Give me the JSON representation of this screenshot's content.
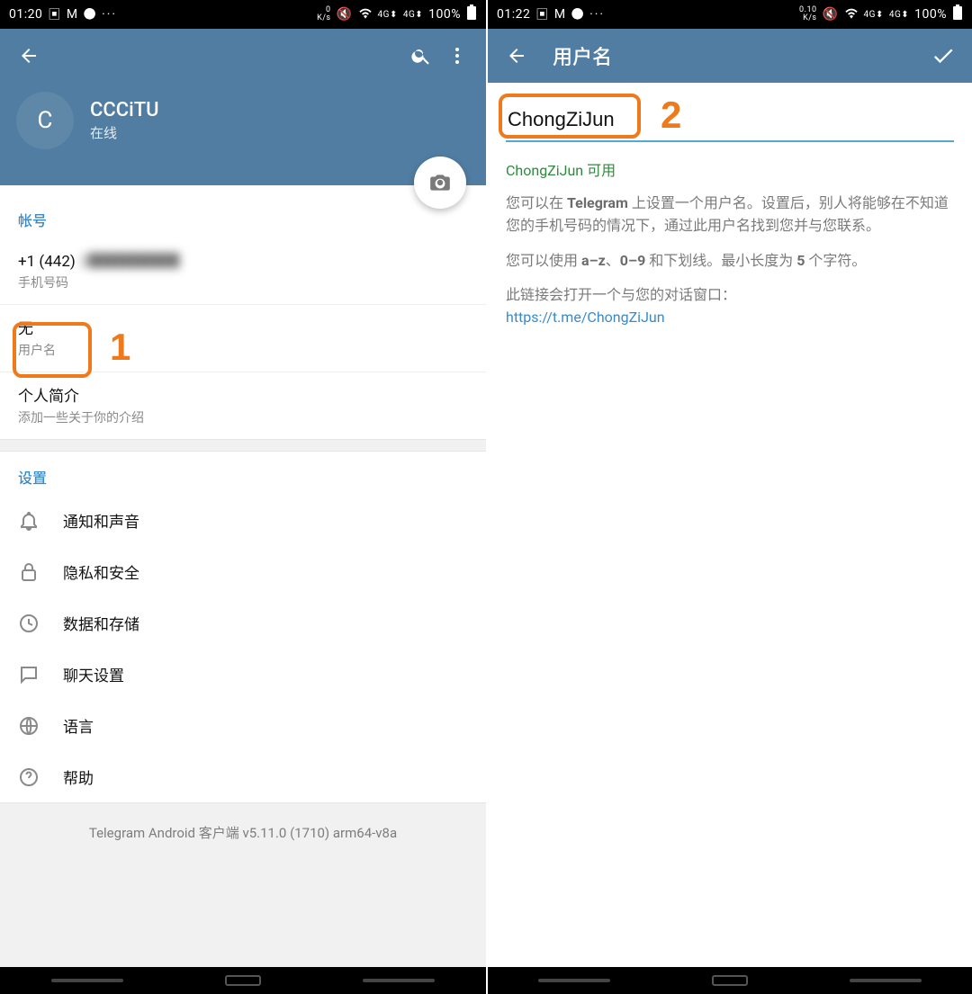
{
  "left": {
    "status": {
      "time": "01:20",
      "net": "0\nK/s",
      "battery": "100%"
    },
    "profile": {
      "avatar_letter": "C",
      "name": "CCCiTU",
      "presence": "在线"
    },
    "account": {
      "header": "帐号",
      "phone_prefix": "+1 (442) ",
      "phone_rest": "2██████",
      "phone_label": "手机号码",
      "username_value": "无",
      "username_label": "用户名",
      "bio_title": "个人简介",
      "bio_hint": "添加一些关于你的介绍"
    },
    "settings": {
      "header": "设置",
      "items": [
        {
          "icon": "bell",
          "label": "通知和声音"
        },
        {
          "icon": "lock",
          "label": "隐私和安全"
        },
        {
          "icon": "clock",
          "label": "数据和存储"
        },
        {
          "icon": "chat",
          "label": "聊天设置"
        },
        {
          "icon": "globe",
          "label": "语言"
        },
        {
          "icon": "help",
          "label": "帮助"
        }
      ]
    },
    "footer": "Telegram Android 客户端 v5.11.0 (1710) arm64-v8a",
    "annotation_number": "1"
  },
  "right": {
    "status": {
      "time": "01:22",
      "net": "0.10\nK/s",
      "battery": "100%"
    },
    "title": "用户名",
    "input_value": "ChongZiJun",
    "available_text": "ChongZiJun 可用",
    "desc1_a": "您可以在 ",
    "desc1_b": "Telegram",
    "desc1_c": " 上设置一个用户名。设置后，别人将能够在不知道您的手机号码的情况下，通过此用户名找到您并与您联系。",
    "desc2_a": "您可以使用 ",
    "desc2_b": "a–z",
    "desc2_c": "、",
    "desc2_d": "0–9",
    "desc2_e": " 和下划线。最小长度为 ",
    "desc2_f": "5",
    "desc2_g": " 个字符。",
    "desc3": "此链接会打开一个与您的对话窗口：",
    "link": "https://t.me/ChongZiJun",
    "annotation_number": "2"
  }
}
